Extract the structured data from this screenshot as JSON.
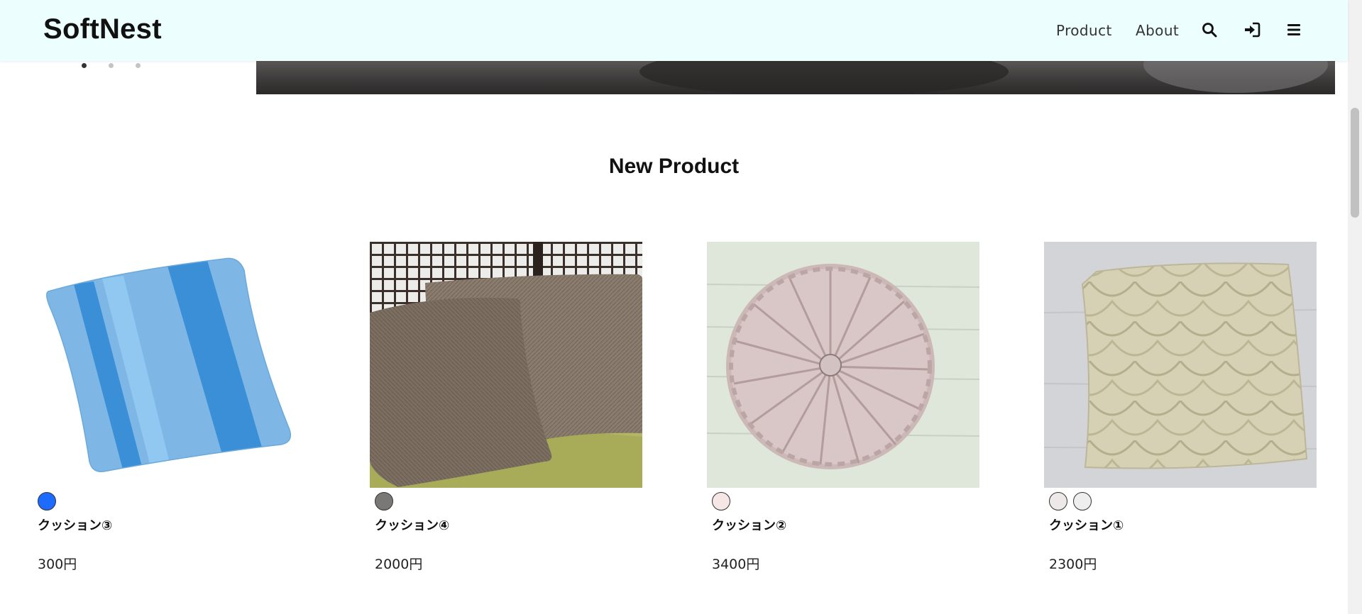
{
  "header": {
    "logo": "SoftNest",
    "nav": [
      {
        "label": "Product"
      },
      {
        "label": "About"
      }
    ],
    "icons": [
      "search-icon",
      "login-icon",
      "menu-icon"
    ]
  },
  "hero": {
    "carousel_dots": 3,
    "active_dot": 1
  },
  "section": {
    "title": "New Product"
  },
  "products": [
    {
      "name": "クッション③",
      "price": "300円",
      "colors": [
        "#1e6bff"
      ]
    },
    {
      "name": "クッション④",
      "price": "2000円",
      "colors": [
        "#7a7876"
      ]
    },
    {
      "name": "クッション②",
      "price": "3400円",
      "colors": [
        "#f6e6e6"
      ]
    },
    {
      "name": "クッション①",
      "price": "2300円",
      "colors": [
        "#ece9e8",
        "#eeeeee"
      ]
    }
  ],
  "colors": {
    "header_bg": "#ecfefe",
    "text": "#111111"
  }
}
